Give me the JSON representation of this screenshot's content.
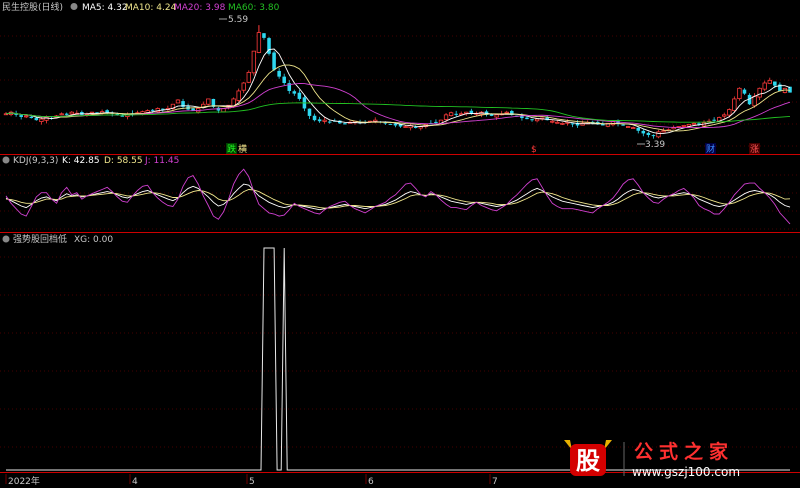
{
  "colors": {
    "bg": "#000000",
    "grid": "#8b0000",
    "divider": "#cc0000",
    "up": "#ff3b3b",
    "down": "#2ed8f0",
    "ma5": "#ffffff",
    "ma10": "#f0e68c",
    "ma20": "#d040d0",
    "ma60": "#22c022",
    "text": "#c8c8c8",
    "k": "#ffffff",
    "d": "#f0e68c",
    "j": "#d040d0",
    "xg": "#e8e8e8"
  },
  "header": {
    "title": "民生控股(日线)",
    "ma5": "MA5: 4.32",
    "ma10": "MA10: 4.24",
    "ma20": "MA20: 3.98",
    "ma60": "MA60: 3.80"
  },
  "kdj_header": {
    "title": "KDJ(9,3,3)",
    "k": "K: 42.85",
    "d": "D: 58.55",
    "j": "J: 11.45"
  },
  "xg_header": {
    "title": "强势股回档低",
    "xg": "XG: 0.00"
  },
  "annotations": {
    "high": "5.59",
    "low": "3.39"
  },
  "markers": [
    "跌",
    "横",
    "$",
    "财",
    "涨"
  ],
  "xaxis": [
    "2022年",
    "4",
    "5",
    "6",
    "7"
  ],
  "watermark": {
    "brand": "公式之家",
    "url": "www.gszj100.com",
    "logo_char": "股"
  },
  "chart_data": [
    {
      "type": "candlestick",
      "title": "民生控股(日线)",
      "series": [
        {
          "name": "MA5",
          "value": 4.32
        },
        {
          "name": "MA10",
          "value": 4.24
        },
        {
          "name": "MA20",
          "value": 3.98
        },
        {
          "name": "MA60",
          "value": 3.8
        }
      ],
      "annotations": [
        {
          "label": "5.59",
          "kind": "high"
        },
        {
          "label": "3.39",
          "kind": "low"
        }
      ],
      "close": [
        3.92,
        3.95,
        3.9,
        3.86,
        3.88,
        3.84,
        3.8,
        3.82,
        3.86,
        3.84,
        3.88,
        3.92,
        3.9,
        3.95,
        3.93,
        3.9,
        3.92,
        3.95,
        3.93,
        3.96,
        3.94,
        3.92,
        3.9,
        3.88,
        3.9,
        3.92,
        3.94,
        3.96,
        3.98,
        3.99,
        4.02,
        4.0,
        4.02,
        4.1,
        4.18,
        4.05,
        4.0,
        3.98,
        4.02,
        4.1,
        4.2,
        4.05,
        3.98,
        4.02,
        4.08,
        4.2,
        4.35,
        4.5,
        4.7,
        5.1,
        5.45,
        5.35,
        5.05,
        4.75,
        4.62,
        4.5,
        4.35,
        4.3,
        4.2,
        4.02,
        3.88,
        3.8,
        3.78,
        3.8,
        3.76,
        3.78,
        3.74,
        3.72,
        3.76,
        3.78,
        3.74,
        3.75,
        3.78,
        3.8,
        3.77,
        3.74,
        3.72,
        3.7,
        3.68,
        3.68,
        3.7,
        3.66,
        3.68,
        3.72,
        3.74,
        3.76,
        3.8,
        3.9,
        3.94,
        3.9,
        3.92,
        3.95,
        3.92,
        3.93,
        3.95,
        3.9,
        3.88,
        3.9,
        3.92,
        3.95,
        3.9,
        3.88,
        3.84,
        3.82,
        3.8,
        3.82,
        3.84,
        3.8,
        3.78,
        3.76,
        3.74,
        3.76,
        3.72,
        3.7,
        3.74,
        3.76,
        3.74,
        3.72,
        3.7,
        3.74,
        3.78,
        3.74,
        3.7,
        3.68,
        3.66,
        3.6,
        3.55,
        3.52,
        3.5,
        3.58,
        3.6,
        3.62,
        3.66,
        3.68,
        3.7,
        3.72,
        3.74,
        3.72,
        3.75,
        3.78,
        3.8,
        3.85,
        3.9,
        4.0,
        4.2,
        4.4,
        4.3,
        4.1,
        4.25,
        4.4,
        4.5,
        4.55,
        4.45,
        4.35,
        4.4,
        4.32
      ]
    },
    {
      "type": "line",
      "title": "KDJ(9,3,3)",
      "series": [
        {
          "name": "K",
          "last": 42.85,
          "values": [
            60,
            55,
            50,
            45,
            42,
            48,
            55,
            60,
            62,
            58,
            55,
            62,
            68,
            64,
            66,
            62,
            64,
            66,
            68,
            70,
            72,
            70,
            66,
            62,
            60,
            64,
            68,
            72,
            74,
            70,
            66,
            62,
            58,
            55,
            60,
            70,
            78,
            82,
            78,
            70,
            62,
            52,
            45,
            48,
            56,
            68,
            78,
            86,
            84,
            74,
            64,
            58,
            52,
            48,
            44,
            42,
            44,
            48,
            46,
            44,
            42,
            40,
            38,
            40,
            42,
            44,
            46,
            48,
            46,
            44,
            42,
            40,
            42,
            44,
            46,
            48,
            52,
            56,
            62,
            68,
            72,
            70,
            66,
            64,
            68,
            66,
            62,
            58,
            54,
            52,
            50,
            48,
            50,
            52,
            50,
            48,
            46,
            44,
            46,
            48,
            52,
            56,
            62,
            68,
            74,
            78,
            74,
            68,
            62,
            58,
            54,
            52,
            50,
            48,
            46,
            44,
            42,
            44,
            46,
            48,
            52,
            58,
            66,
            72,
            76,
            74,
            70,
            66,
            62,
            60,
            62,
            64,
            66,
            68,
            70,
            68,
            64,
            58,
            54,
            50,
            46,
            44,
            46,
            50,
            56,
            62,
            68,
            72,
            74,
            72,
            70,
            66,
            60,
            52,
            46,
            42.85
          ]
        },
        {
          "name": "D",
          "last": 58.55,
          "values": [
            58,
            57,
            55,
            52,
            50,
            50,
            52,
            55,
            58,
            58,
            57,
            58,
            62,
            63,
            64,
            64,
            64,
            65,
            66,
            67,
            68,
            69,
            68,
            66,
            64,
            64,
            65,
            67,
            69,
            70,
            69,
            67,
            64,
            61,
            61,
            64,
            68,
            72,
            74,
            73,
            70,
            65,
            58,
            55,
            55,
            59,
            65,
            72,
            76,
            75,
            72,
            67,
            62,
            57,
            53,
            49,
            47,
            47,
            47,
            46,
            45,
            44,
            42,
            41,
            41,
            42,
            43,
            45,
            46,
            46,
            45,
            44,
            44,
            44,
            45,
            46,
            48,
            51,
            55,
            59,
            64,
            66,
            66,
            65,
            66,
            66,
            65,
            63,
            60,
            57,
            55,
            53,
            52,
            52,
            52,
            51,
            50,
            48,
            48,
            48,
            49,
            51,
            55,
            59,
            64,
            69,
            71,
            70,
            68,
            65,
            61,
            58,
            55,
            53,
            51,
            49,
            47,
            46,
            46,
            46,
            48,
            51,
            56,
            61,
            66,
            69,
            70,
            69,
            67,
            65,
            64,
            64,
            64,
            65,
            66,
            67,
            66,
            64,
            61,
            57,
            54,
            51,
            49,
            49,
            51,
            55,
            59,
            64,
            67,
            69,
            70,
            69,
            66,
            62,
            58,
            58.55
          ]
        },
        {
          "name": "J",
          "last": 11.45,
          "values": [
            64,
            50,
            40,
            30,
            26,
            44,
            62,
            70,
            70,
            58,
            50,
            70,
            80,
            66,
            70,
            58,
            64,
            68,
            72,
            76,
            80,
            72,
            62,
            54,
            52,
            64,
            74,
            82,
            84,
            70,
            60,
            52,
            46,
            44,
            58,
            82,
            98,
            102,
            86,
            64,
            46,
            26,
            20,
            34,
            58,
            86,
            104,
            114,
            100,
            72,
            48,
            40,
            32,
            30,
            26,
            28,
            38,
            50,
            44,
            40,
            36,
            32,
            30,
            38,
            44,
            48,
            52,
            54,
            46,
            40,
            36,
            32,
            38,
            44,
            48,
            52,
            60,
            66,
            76,
            86,
            88,
            78,
            66,
            62,
            72,
            66,
            56,
            48,
            42,
            42,
            40,
            38,
            46,
            52,
            46,
            42,
            38,
            36,
            42,
            48,
            58,
            66,
            76,
            86,
            94,
            96,
            80,
            64,
            50,
            44,
            40,
            40,
            40,
            38,
            36,
            34,
            32,
            40,
            46,
            52,
            60,
            72,
            86,
            94,
            96,
            84,
            70,
            60,
            52,
            50,
            58,
            64,
            68,
            74,
            78,
            70,
            60,
            46,
            40,
            36,
            30,
            30,
            40,
            52,
            66,
            76,
            86,
            88,
            88,
            78,
            70,
            60,
            48,
            32,
            22,
            11.45
          ]
        }
      ]
    },
    {
      "type": "line",
      "title": "强势股回档低",
      "series": [
        {
          "name": "XG",
          "last": 0.0,
          "spikes": [
            {
              "start_index": 51,
              "end_index": 53
            },
            {
              "start_index": 55,
              "end_index": 55
            }
          ]
        }
      ]
    }
  ]
}
